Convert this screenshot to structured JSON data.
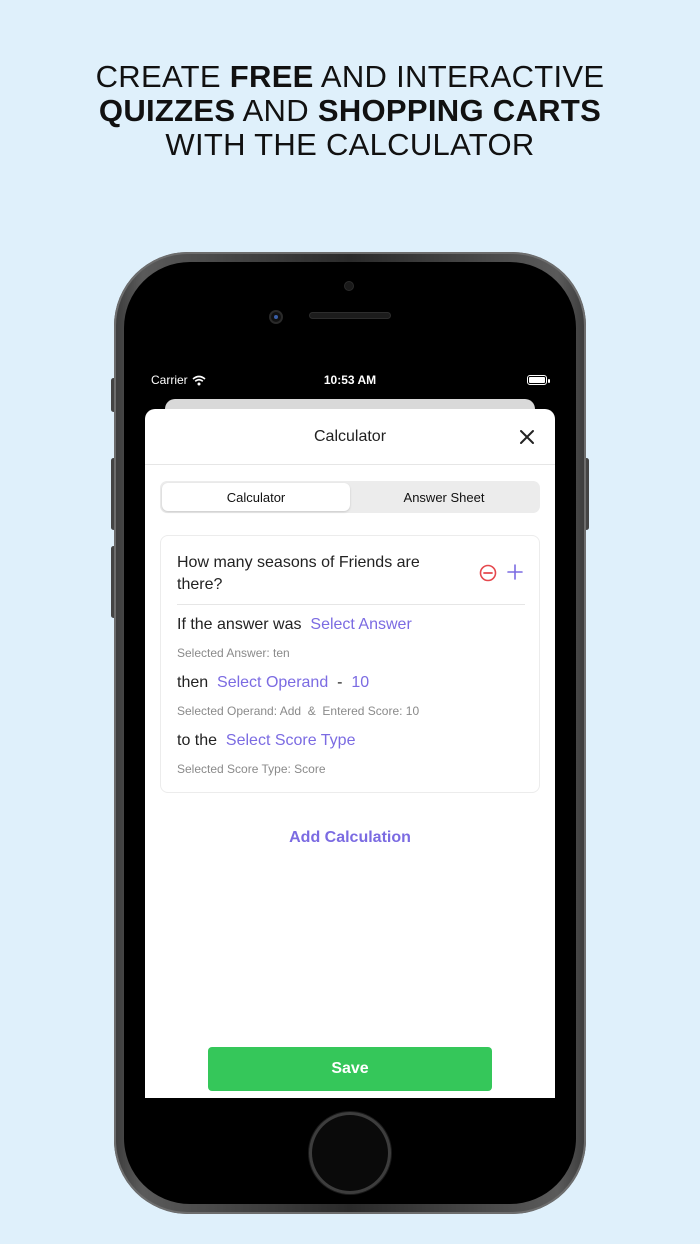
{
  "headline": {
    "line1_pre": "CREATE ",
    "line1_bold": "FREE",
    "line1_post": " AND INTERACTIVE",
    "line2_bold1": "QUIZZES",
    "line2_mid": " AND ",
    "line2_bold2": "SHOPPING CARTS",
    "line3": "WITH THE CALCULATOR"
  },
  "status_bar": {
    "carrier": "Carrier",
    "time": "10:53 AM"
  },
  "sheet": {
    "title": "Calculator",
    "close_icon": "close-icon"
  },
  "tabs": [
    {
      "label": "Calculator",
      "active": true
    },
    {
      "label": "Answer Sheet",
      "active": false
    }
  ],
  "calculation": {
    "question": "How many seasons of Friends are there?",
    "answer_prefix": "If the answer was",
    "answer_link": "Select Answer",
    "answer_selected": "Selected Answer: ten",
    "operand_prefix": "then",
    "operand_link": "Select Operand",
    "operand_dash": "-",
    "score_value": "10",
    "operand_selected": "Selected Operand: Add  &  Entered Score: 10",
    "type_prefix": "to the",
    "type_link": "Select Score Type",
    "type_selected": "Selected Score Type: Score"
  },
  "add_calculation_label": "Add Calculation",
  "save_label": "Save",
  "colors": {
    "background": "#dff0fb",
    "accent": "#7b6be2",
    "save": "#35c75a",
    "remove": "#e5484d"
  }
}
